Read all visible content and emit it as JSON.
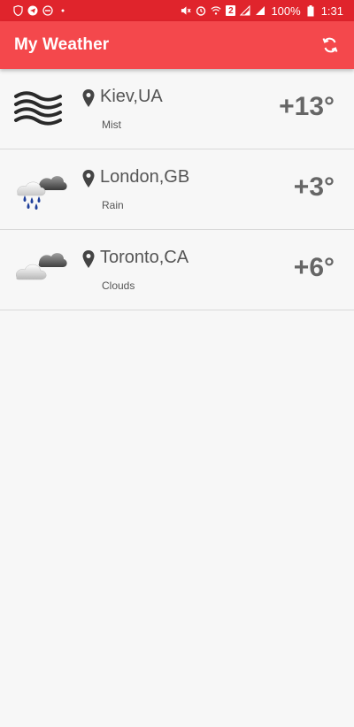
{
  "status_bar": {
    "battery": "100%",
    "time": "1:31",
    "sim_badge": "2",
    "left_icons": [
      "shield-icon",
      "telegram-icon",
      "do-not-disturb-icon",
      "dot-icon"
    ],
    "right_icons": [
      "mute-icon",
      "alarm-icon",
      "wifi-icon",
      "sim-badge",
      "signal-icon",
      "signal-icon",
      "battery-icon"
    ]
  },
  "app_bar": {
    "title": "My Weather",
    "refresh_icon": "refresh-icon"
  },
  "cities": [
    {
      "city": "Kiev,UA",
      "condition": "Mist",
      "temp": "+13°",
      "icon": "mist-icon"
    },
    {
      "city": "London,GB",
      "condition": "Rain",
      "temp": "+3°",
      "icon": "rain-cloud-icon"
    },
    {
      "city": "Toronto,CA",
      "condition": "Clouds",
      "temp": "+6°",
      "icon": "clouds-icon"
    }
  ],
  "colors": {
    "status_bar": "#e0242c",
    "app_bar": "#f4484c",
    "background": "#f7f7f7",
    "text": "#555555",
    "temp": "#666666"
  }
}
